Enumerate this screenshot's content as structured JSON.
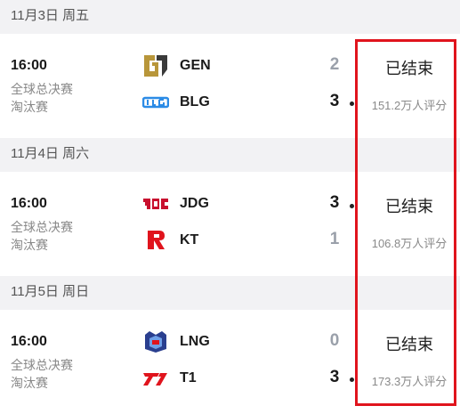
{
  "days": [
    {
      "date": "11月3日 周五",
      "match": {
        "time": "16:00",
        "stage_line1": "全球总决赛",
        "stage_line2": "淘汰赛",
        "team1": {
          "name": "GEN",
          "score": "2",
          "logo": "gen-logo"
        },
        "team2": {
          "name": "BLG",
          "score": "3",
          "logo": "blg-logo"
        },
        "status": "已结束",
        "rating": "151.2万人评分"
      }
    },
    {
      "date": "11月4日 周六",
      "match": {
        "time": "16:00",
        "stage_line1": "全球总决赛",
        "stage_line2": "淘汰赛",
        "team1": {
          "name": "JDG",
          "score": "3",
          "logo": "jdg-logo"
        },
        "team2": {
          "name": "KT",
          "score": "1",
          "logo": "kt-logo"
        },
        "status": "已结束",
        "rating": "106.8万人评分"
      }
    },
    {
      "date": "11月5日 周日",
      "match": {
        "time": "16:00",
        "stage_line1": "全球总决赛",
        "stage_line2": "淘汰赛",
        "team1": {
          "name": "LNG",
          "score": "0",
          "logo": "lng-logo"
        },
        "team2": {
          "name": "T1",
          "score": "3",
          "logo": "t1-logo"
        },
        "status": "已结束",
        "rating": "173.3万人评分"
      }
    }
  ],
  "colors": {
    "highlight": "#e0141d",
    "win_score": "#1a1a1a",
    "lose_score": "#9aa0aa"
  }
}
